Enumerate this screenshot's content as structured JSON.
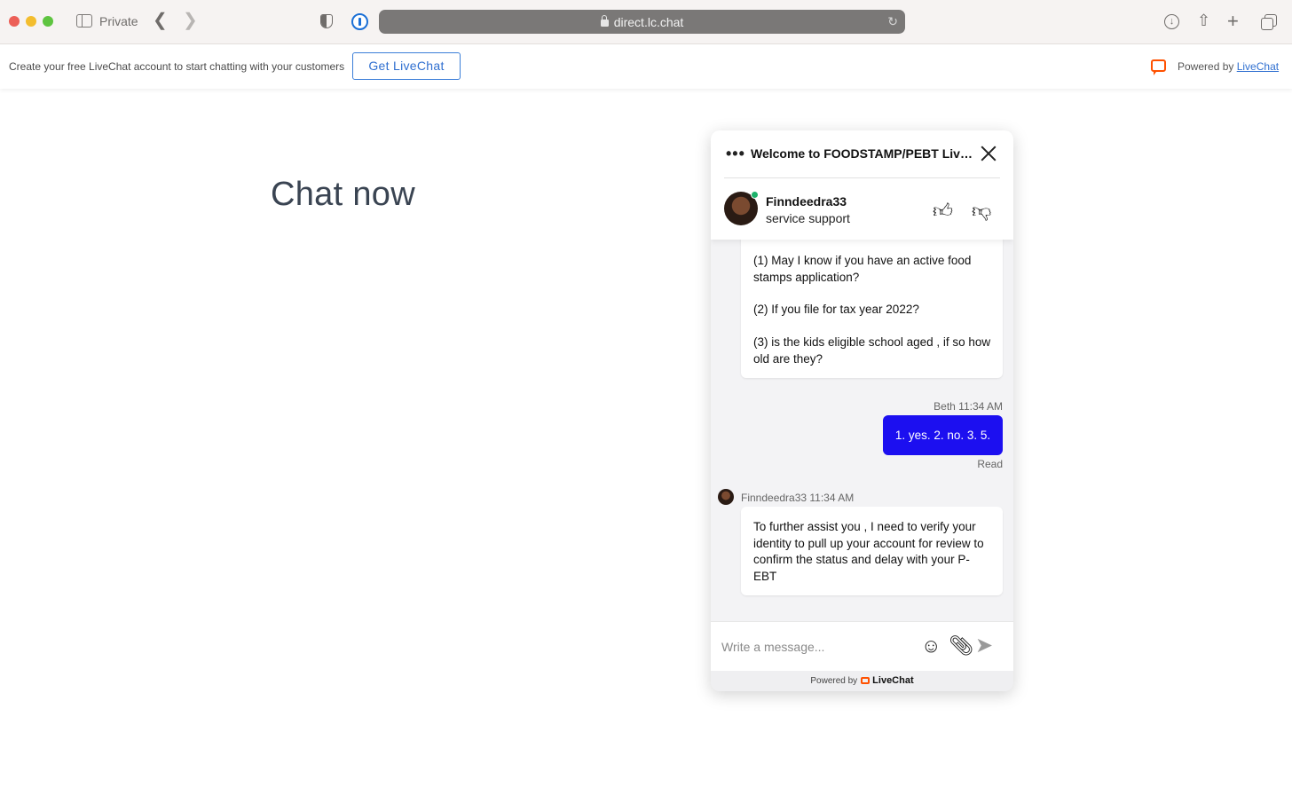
{
  "browser": {
    "private_label": "Private",
    "url": "direct.lc.chat"
  },
  "banner": {
    "promo_text": "Create your free LiveChat account to start chatting with your customers",
    "cta_label": "Get LiveChat",
    "powered_prefix": "Powered by",
    "powered_link": "LiveChat",
    "brand_color": "#ff5100"
  },
  "page": {
    "title": "Chat now"
  },
  "widget": {
    "title": "Welcome to FOODSTAMP/PEBT Live...",
    "agent": {
      "name": "Finndeedra33",
      "role": "service support",
      "status": "online"
    },
    "messages": [
      {
        "author": "Finndeedra33",
        "paragraphs": [
          "(1) May I know if you have an active food stamps application?",
          "(2) If you file for tax year 2022?",
          "(3) is the kids eligible school aged , if so how old are they?"
        ]
      },
      {
        "author": "Beth",
        "meta": "Beth 11:34 AM",
        "text": "1. yes. 2. no. 3. 5.",
        "status": "Read"
      },
      {
        "author": "Finndeedra33",
        "meta": "Finndeedra33 11:34 AM",
        "text": "To further assist you , I need to verify your identity to pull up your account for review to confirm the status and delay with your P-EBT"
      }
    ],
    "composer": {
      "placeholder": "Write a message..."
    },
    "footer": {
      "powered_prefix": "Powered by",
      "brand": "LiveChat"
    },
    "user_bubble_color": "#1c0ff0"
  }
}
